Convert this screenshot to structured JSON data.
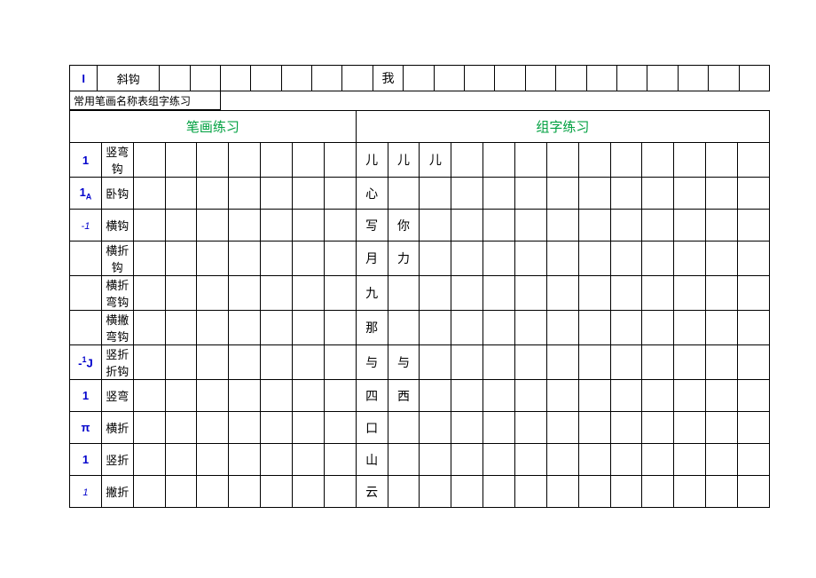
{
  "top_row": {
    "stroke_symbol": "I",
    "stroke_name": "斜钩",
    "char": "我"
  },
  "subtitle": "常用笔画名称表组字练习",
  "headers": {
    "left": "笔画练习",
    "right": "组字练习"
  },
  "rows": [
    {
      "symbol": "1",
      "name": "竖弯钩",
      "chars": [
        "儿",
        "儿",
        "儿"
      ]
    },
    {
      "symbol": "1A",
      "name": "卧钩",
      "chars": [
        "心"
      ]
    },
    {
      "symbol": "-1",
      "name": "横钩",
      "chars": [
        "写",
        "你"
      ]
    },
    {
      "symbol": "",
      "name": "横折钩",
      "chars": [
        "月",
        "力"
      ]
    },
    {
      "symbol": "",
      "name": "横折弯钩",
      "chars": [
        "九"
      ]
    },
    {
      "symbol": "",
      "name": "横撇弯钩",
      "chars": [
        "那"
      ]
    },
    {
      "symbol": "-1J",
      "name": "竖折折钩",
      "chars": [
        "与",
        "与"
      ]
    },
    {
      "symbol": "1",
      "name": "竖弯",
      "chars": [
        "四",
        "西"
      ]
    },
    {
      "symbol": "π",
      "name": "横折",
      "chars": [
        "口"
      ]
    },
    {
      "symbol": "1",
      "name": "竖折",
      "chars": [
        "山"
      ]
    },
    {
      "symbol": "1",
      "name": "撇折",
      "chars": [
        "云"
      ]
    }
  ]
}
